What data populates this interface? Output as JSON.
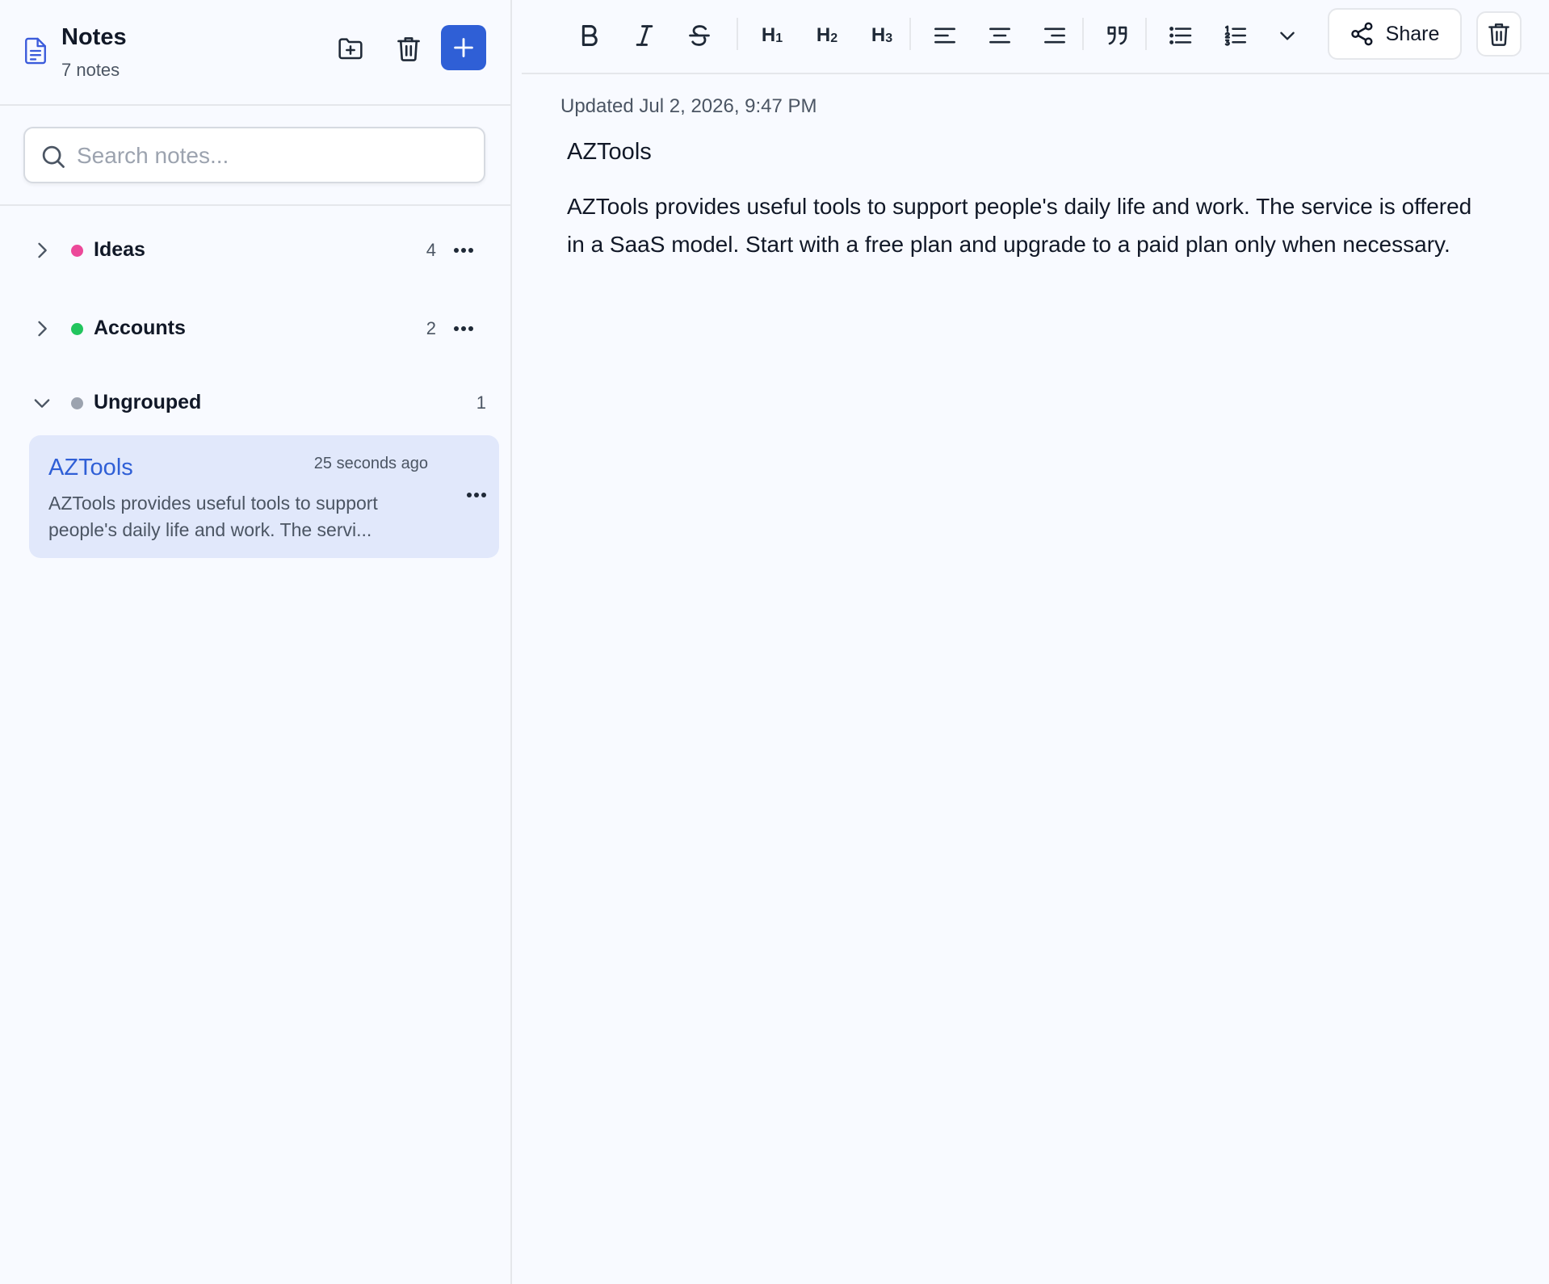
{
  "header": {
    "title": "Notes",
    "count": "7 notes"
  },
  "search": {
    "placeholder": "Search notes...",
    "value": ""
  },
  "groups": [
    {
      "name": "Ideas",
      "count": "4",
      "color": "#ec4899",
      "expanded": false
    },
    {
      "name": "Accounts",
      "count": "2",
      "color": "#22c55e",
      "expanded": false
    },
    {
      "name": "Ungrouped",
      "count": "1",
      "color": "#9ca3af",
      "expanded": true
    }
  ],
  "notes": [
    {
      "title": "AZTools",
      "time": "25 seconds ago",
      "preview": "AZTools provides useful tools to support people's daily life and work. The servi..."
    }
  ],
  "toolbar": {
    "h1": "H",
    "h1_sub": "1",
    "h2": "H",
    "h2_sub": "2",
    "h3": "H",
    "h3_sub": "3",
    "share_label": "Share"
  },
  "editor": {
    "updated": "Updated Jul 2, 2026, 9:47 PM",
    "title": "AZTools",
    "body": "AZTools provides useful tools to support people's daily life and work. The service is offered in a SaaS model. Start with a free plan and upgrade to a paid plan only when necessary."
  },
  "colors": {
    "accent": "#2f5fd6",
    "selected_note_bg": "#e1e8fb"
  }
}
